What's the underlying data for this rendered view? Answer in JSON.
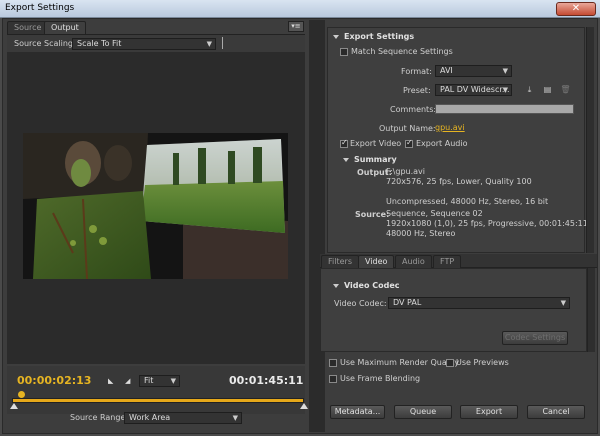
{
  "window": {
    "title": "Export Settings",
    "close_glyph": "✕"
  },
  "left": {
    "tabs": [
      {
        "label": "Source",
        "active": false
      },
      {
        "label": "Output",
        "active": true
      }
    ],
    "panel_menu_glyph": "▾≡",
    "source_scaling_label": "Source Scaling:",
    "source_scaling_value": "Scale To Fit",
    "timecode_current": "00:00:02:13",
    "timecode_end": "00:01:45:11",
    "zoom_value": "Fit",
    "source_range_label": "Source Range:",
    "source_range_value": "Work Area",
    "playhead_progress": 0.03
  },
  "export_settings": {
    "heading": "Export Settings",
    "match_sequence_label": "Match Sequence Settings",
    "match_sequence_checked": false,
    "format_label": "Format:",
    "format_value": "AVI",
    "preset_label": "Preset:",
    "preset_value": "PAL DV Widescr...",
    "comments_label": "Comments:",
    "comments_value": "",
    "output_name_label": "Output Name:",
    "output_name_value": "gpu.avi",
    "export_video_label": "Export Video",
    "export_video_checked": true,
    "export_audio_label": "Export Audio",
    "export_audio_checked": true
  },
  "summary": {
    "heading": "Summary",
    "output_label": "Output:",
    "output_lines": [
      "F:\\gpu.avi",
      "720x576, 25 fps, Lower, Quality 100",
      "",
      "Uncompressed, 48000 Hz, Stereo, 16 bit"
    ],
    "source_label": "Source:",
    "source_lines": [
      "Sequence, Sequence 02",
      "1920x1080 (1,0), 25 fps, Progressive, 00:01:45:11",
      "48000 Hz, Stereo"
    ]
  },
  "settings_tabs": [
    {
      "label": "Filters",
      "active": false
    },
    {
      "label": "Video",
      "active": true
    },
    {
      "label": "Audio",
      "active": false
    },
    {
      "label": "FTP",
      "active": false
    }
  ],
  "video_codec": {
    "heading": "Video Codec",
    "codec_label": "Video Codec:",
    "codec_value": "DV PAL",
    "codec_settings_button": "Codec Settings"
  },
  "bottom_options": {
    "max_render_quality_label": "Use Maximum Render Quality",
    "use_previews_label": "Use Previews",
    "frame_blending_label": "Use Frame Blending"
  },
  "buttons": {
    "metadata": "Metadata...",
    "queue": "Queue",
    "export": "Export",
    "cancel": "Cancel"
  },
  "colors": {
    "accent": "#e6b422",
    "panel_bg": "#3d3d3d",
    "preview_bg": "#2b2b2b"
  }
}
